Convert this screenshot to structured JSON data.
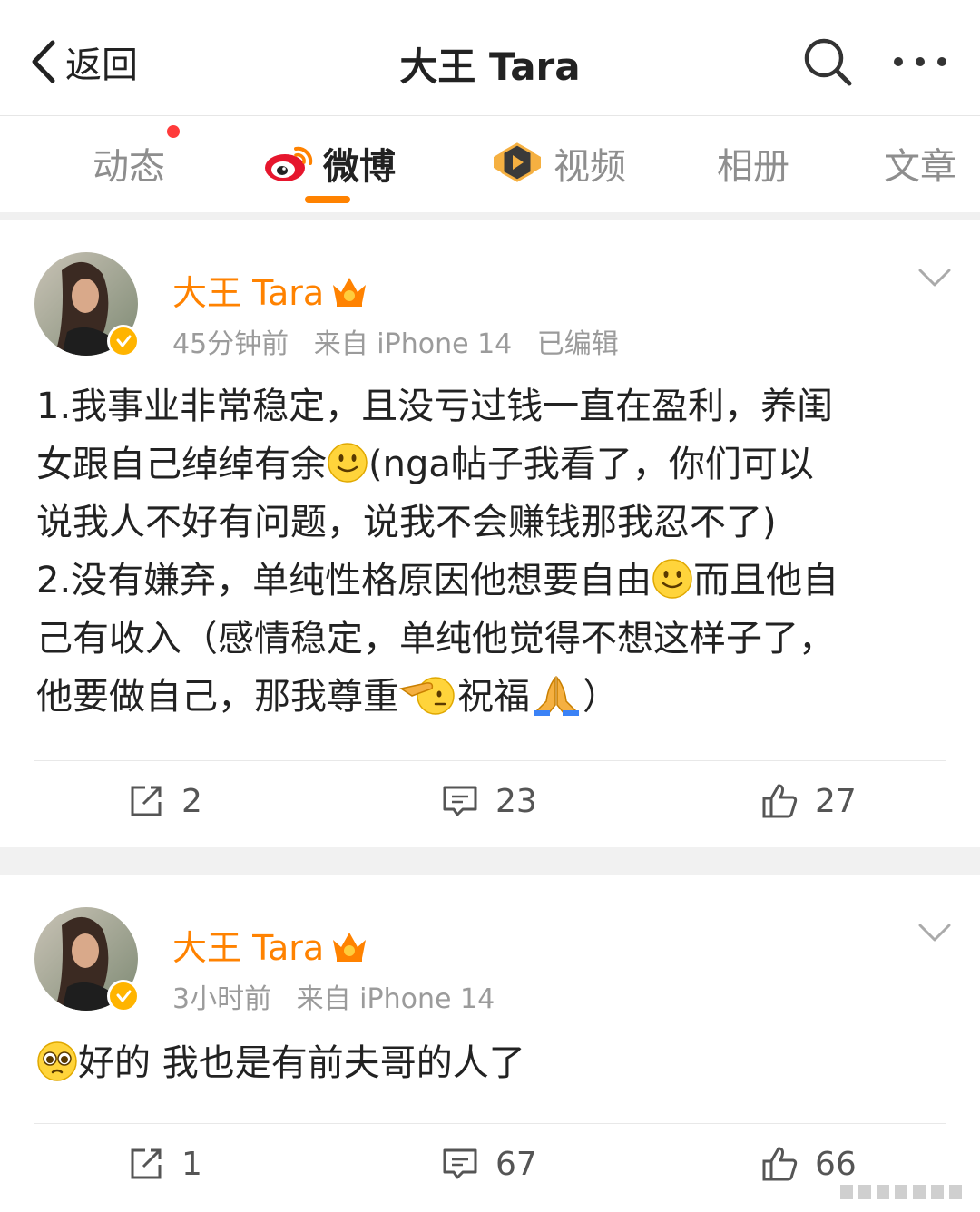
{
  "header": {
    "back_label": "返回",
    "title": "大王 Tara"
  },
  "tabs": [
    {
      "label": "动态"
    },
    {
      "label": "微博"
    },
    {
      "label": "视频"
    },
    {
      "label": "相册"
    },
    {
      "label": "文章"
    }
  ],
  "posts": [
    {
      "author": "大王 Tara",
      "time": "45分钟前",
      "source": "来自 iPhone 14",
      "edited": "已编辑",
      "lines": {
        "l1": "1.我事业非常稳定，且没亏过钱一直在盈利，养闺",
        "l2a": "女跟自己绰绰有余",
        "l2b": "(nga帖子我看了，你们可以",
        "l3": "说我人不好有问题，说我不会赚钱那我忍不了)",
        "l4a": "2.没有嫌弃，单纯性格原因他想要自由",
        "l4b": "而且他自",
        "l5": "己有收入（感情稳定，单纯他觉得不想这样子了，",
        "l6a": "他要做自己，那我尊重",
        "l6b": "祝福",
        "l6c": "）"
      },
      "reposts": "2",
      "comments": "23",
      "likes": "27"
    },
    {
      "author": "大王 Tara",
      "time": "3小时前",
      "source": "来自 iPhone 14",
      "text": "好的 我也是有前夫哥的人了",
      "reposts": "1",
      "comments": "67",
      "likes": "66"
    }
  ],
  "colors": {
    "accent": "#ff8200",
    "badge": "#ffb400",
    "notification_dot": "#ff3b3b"
  },
  "icons": {
    "back": "chevron-left-icon",
    "search": "search-icon",
    "more": "more-icon",
    "repost": "repost-icon",
    "comment": "comment-icon",
    "like": "like-icon"
  }
}
